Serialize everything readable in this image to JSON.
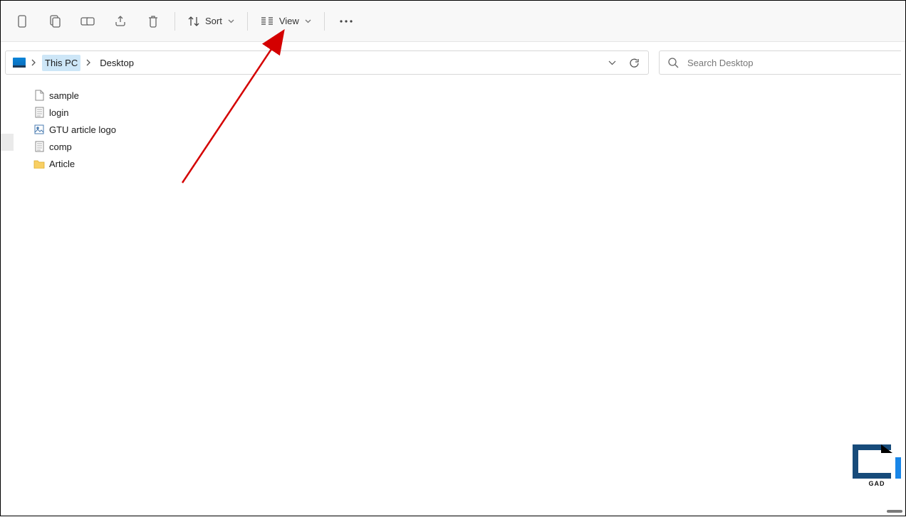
{
  "toolbar": {
    "sort_label": "Sort",
    "view_label": "View"
  },
  "breadcrumb": {
    "items": [
      "This PC",
      "Desktop"
    ],
    "active_index": 0
  },
  "search": {
    "placeholder": "Search Desktop"
  },
  "files": [
    {
      "name": "sample",
      "icon": "file"
    },
    {
      "name": "login",
      "icon": "text"
    },
    {
      "name": "GTU article logo",
      "icon": "image"
    },
    {
      "name": "comp",
      "icon": "text"
    },
    {
      "name": "Article",
      "icon": "folder"
    }
  ],
  "watermark": {
    "text": "GAD"
  }
}
